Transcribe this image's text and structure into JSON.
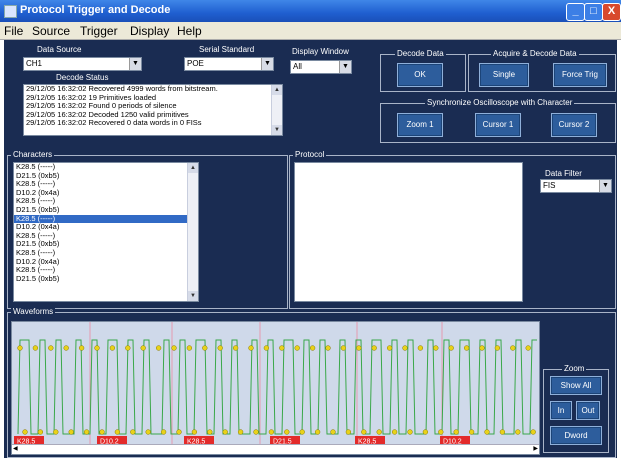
{
  "window": {
    "title": "Protocol Trigger and Decode",
    "minimize": "_",
    "maximize": "□",
    "close": "X"
  },
  "menu": [
    "File",
    "Source",
    "Trigger",
    "Display",
    "Help"
  ],
  "data_source": {
    "label": "Data Source",
    "value": "CH1"
  },
  "serial_standard": {
    "label": "Serial Standard",
    "value": "POE"
  },
  "display_window": {
    "label": "Display Window",
    "value": "All"
  },
  "decode_status": {
    "label": "Decode Status",
    "lines": [
      "29/12/05 16:32:02 Recovered 4999 words from bitstream.",
      "29/12/05 16:32:02 19 Primitives loaded",
      "29/12/05 16:32:02 Found 0 periods of silence",
      "29/12/05 16:32:02 Decoded 1250 valid primitives",
      "29/12/05 16:32:02 Recovered 0 data words in 0 FISs"
    ]
  },
  "decode_data": {
    "label": "Decode Data",
    "ok": "OK"
  },
  "acquire": {
    "label": "Acquire & Decode Data",
    "single": "Single",
    "force_trig": "Force Trig"
  },
  "sync": {
    "label": "Synchronize Oscilloscope with Character",
    "zoom1": "Zoom 1",
    "cursor1": "Cursor 1",
    "cursor2": "Cursor 2"
  },
  "characters": {
    "label": "Characters",
    "rows": [
      "K28.5 (-----)",
      "D21.5 (0xb5)",
      "K28.5 (-----)",
      "D10.2 (0x4a)",
      "K28.5 (-----)",
      "D21.5 (0xb5)",
      "K28.5 (-----)",
      "D10.2 (0x4a)",
      "K28.5 (-----)",
      "D21.5 (0xb5)",
      "K28.5 (-----)",
      "D10.2 (0x4a)",
      "K28.5 (-----)",
      "D21.5 (0xb5)"
    ],
    "selected": 6
  },
  "protocol": {
    "label": "Protocol"
  },
  "data_filter": {
    "label": "Data Filter",
    "value": "FIS"
  },
  "waveforms": {
    "label": "Waveforms",
    "markers": [
      "K28.5",
      "D10.2",
      "K28.5",
      "D21.5",
      "K28.5",
      "D10.2"
    ]
  },
  "zoom": {
    "label": "Zoom",
    "show_all": "Show All",
    "in": "In",
    "out": "Out",
    "dword": "Dword"
  },
  "colors": {
    "bg": "#1a2c52",
    "wave_bg": "#cfd9ea",
    "marker": "#e32a2a",
    "trace": "#3aa84a",
    "dot": "#e8d21a"
  }
}
